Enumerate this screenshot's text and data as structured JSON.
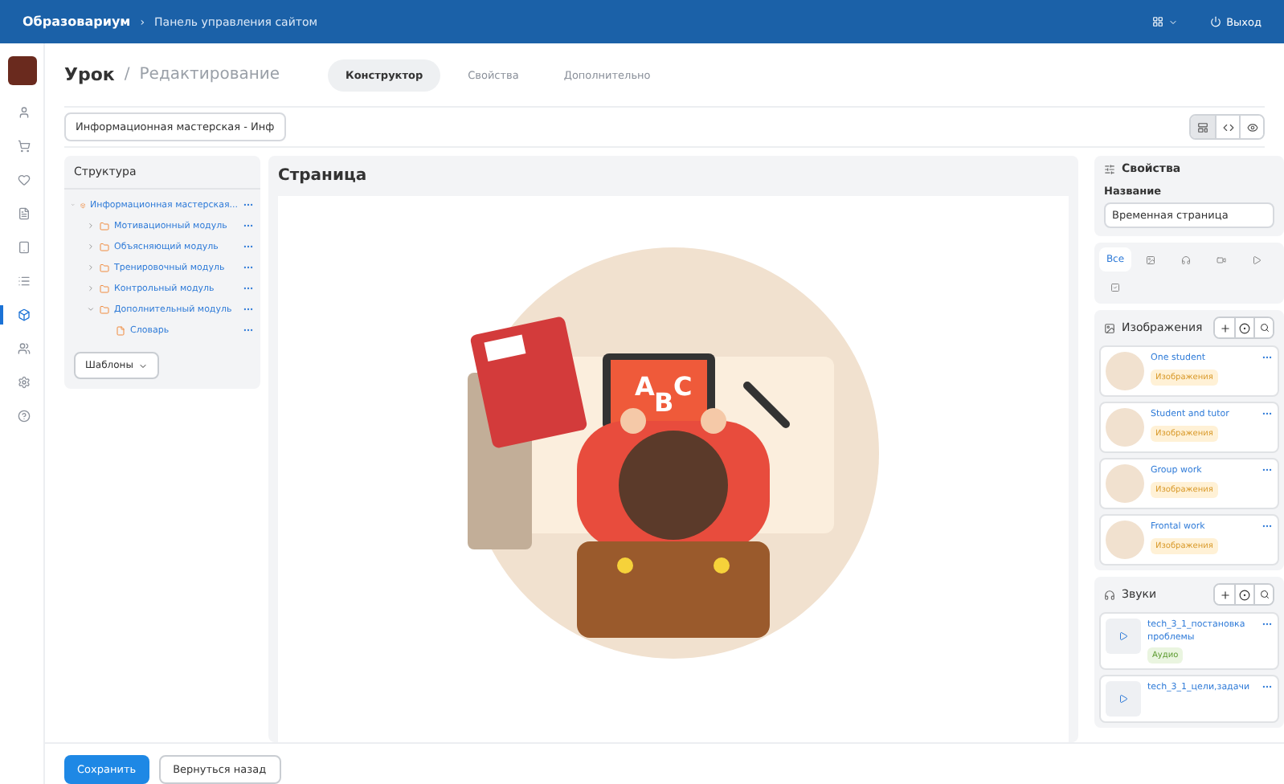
{
  "topbar": {
    "brand": "Образовариум",
    "separator": "›",
    "section": "Панель управления сайтом",
    "logout": "Выход"
  },
  "nav": [
    {
      "kind": "user",
      "selected": false
    },
    {
      "kind": "cart",
      "selected": false
    },
    {
      "kind": "heart",
      "selected": false
    },
    {
      "kind": "file",
      "selected": false
    },
    {
      "kind": "tablet",
      "selected": false
    },
    {
      "kind": "list",
      "selected": false
    },
    {
      "kind": "box",
      "selected": true
    },
    {
      "kind": "users",
      "selected": false
    },
    {
      "kind": "gear",
      "selected": false
    },
    {
      "kind": "help",
      "selected": false
    }
  ],
  "header": {
    "title": "Урок",
    "slash": "/",
    "subtitle": "Редактирование"
  },
  "tabs": [
    {
      "label": "Конструктор",
      "selected": true
    },
    {
      "label": "Свойства",
      "selected": false
    },
    {
      "label": "Дополнительно",
      "selected": false
    }
  ],
  "lesson_select": {
    "value": "Информационная мастерская - Инф"
  },
  "view_modes": [
    {
      "kind": "layout",
      "selected": true
    },
    {
      "kind": "code",
      "selected": false
    },
    {
      "kind": "eye",
      "selected": false
    }
  ],
  "structure": {
    "title": "Структура",
    "tree": [
      {
        "label": "Информационная мастерская...",
        "kind": "module",
        "expanded": true,
        "children": [
          {
            "label": "Мотивационный модуль",
            "kind": "folder",
            "expanded": false
          },
          {
            "label": "Объясняющий модуль",
            "kind": "folder",
            "expanded": false
          },
          {
            "label": "Тренировочный модуль",
            "kind": "folder",
            "expanded": false
          },
          {
            "label": "Контрольный модуль",
            "kind": "folder",
            "expanded": false
          },
          {
            "label": "Дополнительный модуль",
            "kind": "folder",
            "expanded": true,
            "children": [
              {
                "label": "Словарь",
                "kind": "page"
              }
            ]
          }
        ]
      }
    ],
    "templates_button": "Шаблоны"
  },
  "page": {
    "title": "Страница",
    "tablet_letters": [
      "A",
      "B",
      "C"
    ]
  },
  "properties": {
    "title": "Свойства",
    "name_label": "Название",
    "name_value": "Временная страница"
  },
  "media_filters": [
    {
      "kind": "all",
      "label": "Все",
      "selected": true
    },
    {
      "kind": "image",
      "selected": false
    },
    {
      "kind": "audio",
      "selected": false
    },
    {
      "kind": "video",
      "selected": false
    },
    {
      "kind": "play",
      "selected": false
    },
    {
      "kind": "test",
      "selected": false
    }
  ],
  "images": {
    "title": "Изображения",
    "items": [
      {
        "name": "One student",
        "badge": "Изображения"
      },
      {
        "name": "Student and tutor",
        "badge": "Изображения"
      },
      {
        "name": "Group work",
        "badge": "Изображения"
      },
      {
        "name": "Frontal work",
        "badge": "Изображения"
      }
    ]
  },
  "sounds": {
    "title": "Звуки",
    "items": [
      {
        "name": "tech_3_1_постановка проблемы",
        "badge": "Аудио"
      },
      {
        "name": "tech_3_1_цели,задачи"
      }
    ]
  },
  "footer": {
    "save": "Сохранить",
    "back": "Вернуться назад"
  }
}
